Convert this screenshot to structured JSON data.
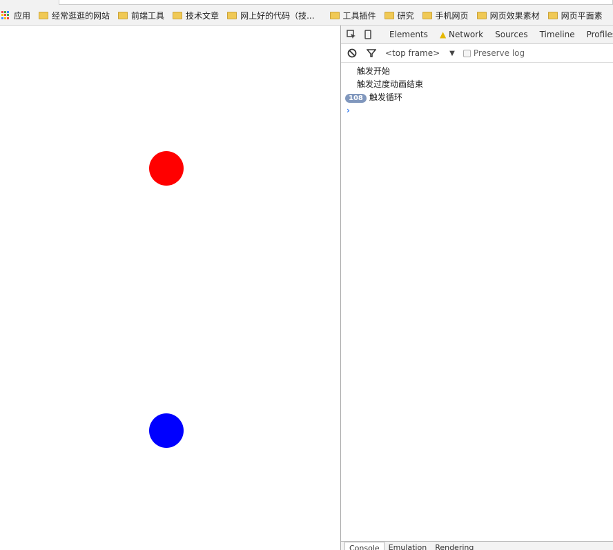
{
  "bookmarks": {
    "apps_label": "应用",
    "items": [
      "经常逛逛的网站",
      "前端工具",
      "技术文章",
      "网上好的代码（技...",
      "工具插件",
      "研究",
      "手机网页",
      "网页效果素材",
      "网页平面素"
    ]
  },
  "page": {
    "balls": [
      {
        "color": "#ff0000"
      },
      {
        "color": "#0000ff"
      }
    ]
  },
  "devtools": {
    "tabs": [
      "Elements",
      "Network",
      "Sources",
      "Timeline",
      "Profiles"
    ],
    "network_warning": true,
    "console_toolbar": {
      "frame": "<top frame>",
      "preserve_log": "Preserve log",
      "preserve_checked": false
    },
    "messages": [
      {
        "text": "触发开始"
      },
      {
        "text": "触发过度动画结束"
      },
      {
        "count": "108",
        "text": "触发循环"
      }
    ],
    "prompt": "›",
    "drawer_tabs": [
      "Console",
      "Emulation",
      "Rendering"
    ]
  }
}
